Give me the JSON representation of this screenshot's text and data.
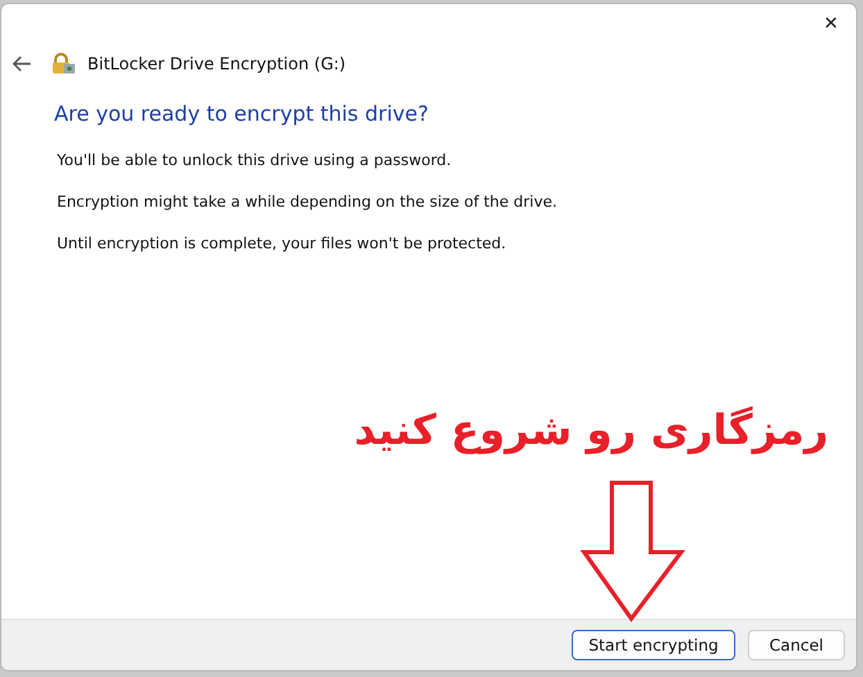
{
  "window": {
    "title": "BitLocker Drive Encryption (G:)",
    "close": "✕"
  },
  "heading": "Are you ready to encrypt this drive?",
  "paragraphs": [
    "You'll be able to unlock this drive using a password.",
    "Encryption might take a while depending on the size of the drive.",
    "Until encryption is complete, your files won't be protected."
  ],
  "annotation": {
    "text": "رمزگاری رو شروع کنید"
  },
  "buttons": [
    {
      "label": "Start encrypting",
      "kind": "primary"
    },
    {
      "label": "Cancel",
      "kind": "secondary"
    }
  ]
}
